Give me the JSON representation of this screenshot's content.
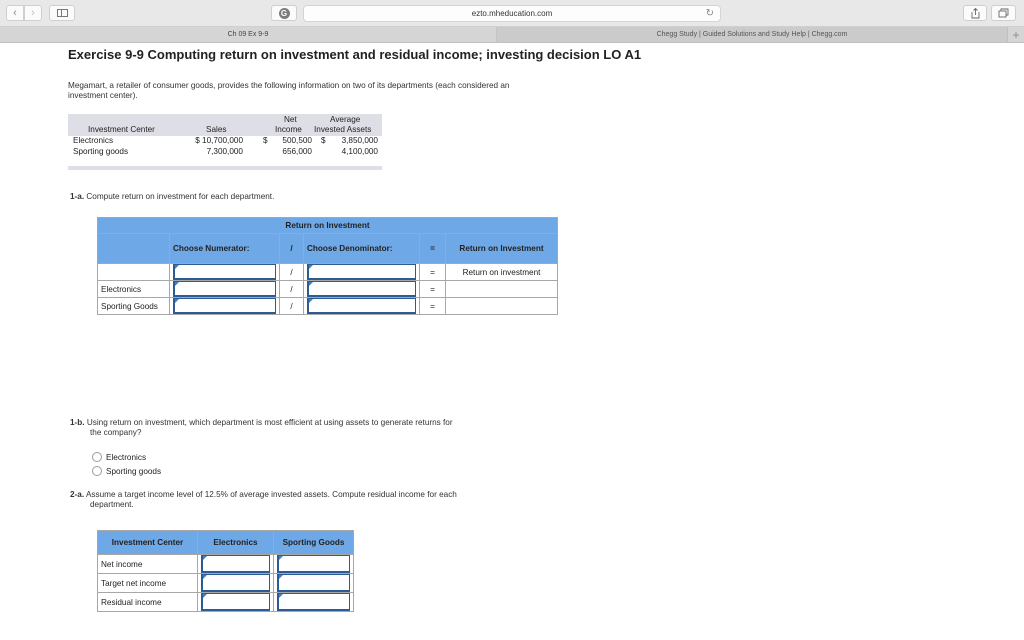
{
  "browser": {
    "url": "ezto.mheducation.com",
    "extension_icon_letter": "G",
    "tabs": [
      {
        "label": "Ch 09 Ex 9-9",
        "active": true
      },
      {
        "label": "Chegg Study | Guided Solutions and Study Help | Chegg.com",
        "active": false
      }
    ],
    "new_tab_label": "+"
  },
  "page": {
    "title": "Exercise 9-9 Computing return on investment and residual income; investing decision LO A1",
    "intro": "Megamart, a retailer of consumer goods, provides the following information on two of its departments (each considered an investment center).",
    "data_table": {
      "headers": {
        "center": "Investment Center",
        "sales": "Sales",
        "net_income_line1": "Net",
        "net_income_line2": "Income",
        "assets_line1": "Average",
        "assets_line2": "Invested Assets"
      },
      "rows": [
        {
          "center": "Electronics",
          "sales": "$ 10,700,000",
          "ni_sign": "$",
          "net_income": "500,500",
          "assets_sign": "$",
          "assets": "3,850,000"
        },
        {
          "center": "Sporting goods",
          "sales": "7,300,000",
          "ni_sign": "",
          "net_income": "656,000",
          "assets_sign": "",
          "assets": "4,100,000"
        }
      ]
    },
    "q1a": {
      "label": "1-a.",
      "text": "Compute return on investment for each department.",
      "table": {
        "title": "Return on Investment",
        "headers": [
          "",
          "Choose Numerator:",
          "/",
          "Choose Denominator:",
          "=",
          "Return on Investment"
        ],
        "rows": [
          {
            "label": "",
            "numerator": "",
            "div": "/",
            "denominator": "",
            "eq": "=",
            "result": "Return on investment"
          },
          {
            "label": "Electronics",
            "numerator": "",
            "div": "/",
            "denominator": "",
            "eq": "=",
            "result": ""
          },
          {
            "label": "Sporting Goods",
            "numerator": "",
            "div": "/",
            "denominator": "",
            "eq": "=",
            "result": ""
          }
        ]
      }
    },
    "q1b": {
      "label": "1-b.",
      "text_line1": "Using return on investment, which department is most efficient at using assets to generate returns for",
      "text_line2": "the company?",
      "options": [
        "Electronics",
        "Sporting goods"
      ]
    },
    "q2a": {
      "label": "2-a.",
      "text_line1": "Assume a target income level of 12.5% of average invested assets. Compute residual income for each",
      "text_line2": "department.",
      "table": {
        "headers": [
          "Investment Center",
          "Electronics",
          "Sporting Goods"
        ],
        "rows": [
          {
            "label": "Net income",
            "electronics": "",
            "sporting": ""
          },
          {
            "label": "Target net income",
            "electronics": "",
            "sporting": ""
          },
          {
            "label": "Residual income",
            "electronics": "",
            "sporting": ""
          }
        ]
      }
    }
  },
  "colors": {
    "table_header_blue": "#6fa8e6",
    "input_border": "#2d5b94",
    "data_table_band": "#dedfe6"
  }
}
